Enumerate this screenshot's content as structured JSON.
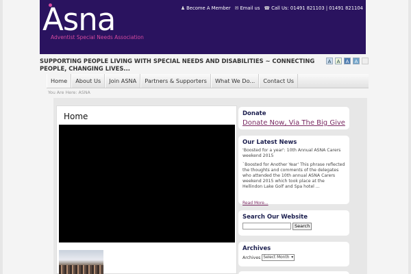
{
  "header": {
    "logo_text": "Asna",
    "logo_sub": "Adventist Special Needs Association",
    "top_links": {
      "become_member": "Become A Member",
      "email": "Email us",
      "call": "Call Us: 01491 821103 | 01491 821104"
    }
  },
  "tagline": "SUPPORTING PEOPLE LIVING WITH SPECIAL NEEDS AND DISABILITIES ~ CONNECTING PEOPLE, CHANGING LIVES...",
  "font_sizer": [
    "A",
    "A",
    "A",
    "A",
    ""
  ],
  "nav": {
    "items": [
      {
        "label": "Home"
      },
      {
        "label": "About Us"
      },
      {
        "label": "Join ASNA"
      },
      {
        "label": "Partners & Supporters"
      },
      {
        "label": "What We Do..."
      },
      {
        "label": "Contact Us"
      }
    ]
  },
  "breadcrumb": "You Are Here: ASNA",
  "main": {
    "title": "Home"
  },
  "sidebar": {
    "donate": {
      "title": "Donate",
      "link": "Donate Now, Via The Big Give"
    },
    "news": {
      "title": "Our Latest News",
      "post_title": "'Boosted for a year': 10th Annual ASNA Carers weekend 2015",
      "excerpt": "`Boosted for Another Year' This phrase reflected the thoughts and comments of the delegates who attended the 10th annual ASNA Carers weekend 2015 which took place at the Hellindon Lake Golf and Spa hotel ...",
      "read_more": "Read More..."
    },
    "search": {
      "title": "Search Our Website",
      "placeholder": "",
      "button": "Search"
    },
    "archives": {
      "title": "Archives",
      "label": "Archives",
      "selected": "Select Month"
    }
  },
  "colors": {
    "header_bg": "#2a135f",
    "accent_pink": "#d64aa0",
    "link_purple": "#7a2a62",
    "widget_title": "#1b1e4e"
  }
}
